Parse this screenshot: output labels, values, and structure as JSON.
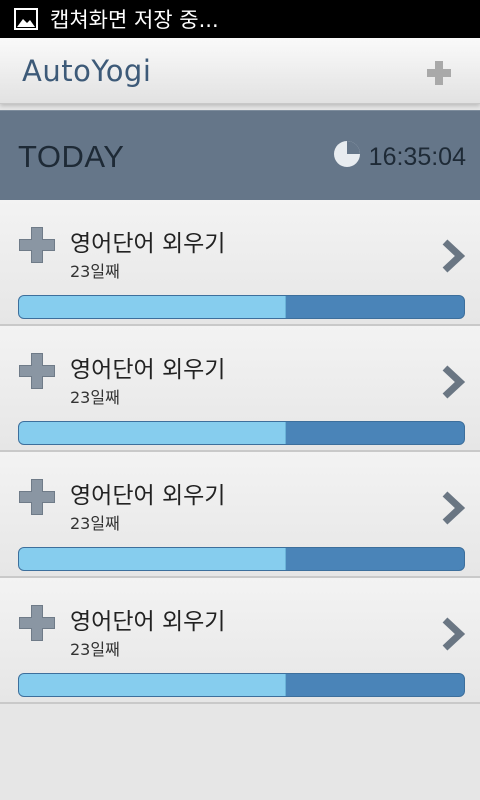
{
  "status_bar": {
    "text": "캡쳐화면 저장 중...",
    "icon": "picture-icon"
  },
  "header": {
    "logo": "AutoYogi",
    "add_icon": "add-icon"
  },
  "today": {
    "label": "TODAY",
    "time": "16:35:04",
    "clock_icon": "clock-icon"
  },
  "items": [
    {
      "title": "영어단어 외우기",
      "subtitle": "23일째",
      "progress": 0.6
    },
    {
      "title": "영어단어 외우기",
      "subtitle": "23일째",
      "progress": 0.6
    },
    {
      "title": "영어단어 외우기",
      "subtitle": "23일째",
      "progress": 0.6
    },
    {
      "title": "영어단어 외우기",
      "subtitle": "23일째",
      "progress": 0.6
    }
  ],
  "colors": {
    "accent": "#3d5a78",
    "today_bg": "#657689",
    "progress_bg": "#4a84b8",
    "progress_fill": "#86cdee"
  }
}
